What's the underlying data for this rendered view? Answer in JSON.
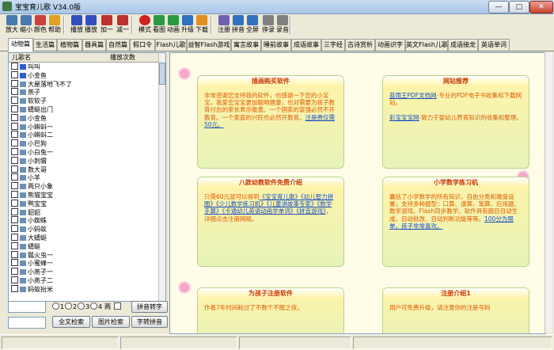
{
  "window": {
    "title": "宝宝育儿歌 V34.0版",
    "min": "—",
    "max": "□",
    "close": "✕"
  },
  "toolbar": {
    "buttons": [
      {
        "label": "放大",
        "icon": "zoom-in-icon",
        "color": "#4a7ab0"
      },
      {
        "label": "缩小",
        "icon": "zoom-out-icon",
        "color": "#4a7ab0"
      },
      {
        "label": "颜色",
        "icon": "color-icon",
        "color": "#d04040"
      },
      {
        "label": "帮助",
        "icon": "help-icon",
        "color": "#e0a020"
      },
      {
        "label": "播放",
        "icon": "play-icon",
        "color": "#3050c0"
      },
      {
        "label": "播放",
        "icon": "play-all-icon",
        "color": "#3050c0"
      },
      {
        "label": "加一",
        "icon": "add-icon",
        "color": "#c03030"
      },
      {
        "label": "减一",
        "icon": "minus-icon",
        "color": "#c03030"
      },
      {
        "label": "模式",
        "icon": "mode-icon",
        "color": "#d02020"
      },
      {
        "label": "看图",
        "icon": "image-icon",
        "color": "#2a9a40"
      },
      {
        "label": "动画",
        "icon": "animation-icon",
        "color": "#2a9a40"
      },
      {
        "label": "升级",
        "icon": "upgrade-icon",
        "color": "#3070c0"
      },
      {
        "label": "下载",
        "icon": "download-icon",
        "color": "#e09020"
      },
      {
        "label": "注册",
        "icon": "register-icon",
        "color": "#7060b0"
      },
      {
        "label": "拼音",
        "icon": "pinyin-icon",
        "color": "#3070c0"
      },
      {
        "label": "全屏",
        "icon": "fullscreen-icon",
        "color": "#3070c0"
      },
      {
        "label": "停录",
        "icon": "stop-record-icon",
        "color": "#808080"
      },
      {
        "label": "录音",
        "icon": "record-icon",
        "color": "#808080"
      }
    ]
  },
  "tabs": [
    "动物篇",
    "生活篇",
    "植物篇",
    "器具篇",
    "自然篇",
    "假口令",
    "Flash儿歌",
    "益智Flash游戏",
    "寓言故事",
    "睡前故事",
    "成语故事",
    "三字经",
    "古诗赏析",
    "动画识字",
    "英文Flash儿歌",
    "成语接龙",
    "英语单词"
  ],
  "list": {
    "headers": {
      "name": "儿歌名",
      "count": "播放次数"
    },
    "items": [
      "叫叫",
      "小金鱼",
      "大屋落地飞不了",
      "燕子",
      "软软子",
      "蜻蜓出门",
      "小金鱼",
      "小蝌蚪一",
      "小蝌蚪二",
      "小巴狗",
      "小白兔一",
      "小刺猬",
      "数大哥",
      "小羊",
      "两只小象",
      "熊猫宝宝",
      "鸭宝宝",
      "貂貂",
      "小蜘蛛",
      "小蚂蚁",
      "大蜻蜓",
      "蜻蜓",
      "瓢火虫一",
      "小蜜蜂一",
      "小燕子一",
      "小燕子二",
      "蚂蚁抬米"
    ]
  },
  "search": {
    "radio_options": [
      "1",
      "2",
      "3",
      "4"
    ],
    "radio_suffix": "两",
    "check_label": "",
    "pinyin_btn": "拼音转字",
    "fulltext_btn": "全文检索",
    "image_btn": "图片检索",
    "char_pinyin_btn": "字转拼音"
  },
  "cards": [
    {
      "title": "插画购买软件",
      "body": "非常感谢您支持我的软件，也感谢一下您的小宝宝，我爱您宝宝更加聪明健康，也对需要为孩子教育付出的家长表示敬意。一个国家的富强必然不开教育。一个家庭的兴旺也必然开教育。",
      "link": "注册费仅需50元。"
    },
    {
      "title": "网站推荐",
      "body": "-专业的PDF电子书收集和下载网站。",
      "link1": "蓝雨王PDF文档网",
      "body2": "-致力于婴幼儿养育知识的收集和整理。",
      "link2": "彩宝宝宝网"
    },
    {
      "title": "八款幼教软件免费介绍",
      "body": "只需60元就可以得到",
      "link": "《宝宝育儿歌》《幼儿智力拼图》《少儿数学练习机》《儿童讲故事专家》《数学手算》《卡通幼儿英语动画学单词》《拼音游戏》",
      "body2": "，详细点击注册网链。"
    },
    {
      "title": "小学数学练习机",
      "body": "囊括了小学数学的所有知识，自由分类和难度设置，支持多种题型：口算、速算、笔算、应用题、数学游戏、Flash同步教学。软件具有题目自动生成、自动批改、自动判断功能等等。",
      "link": "100分为限单，孩子非常喜欢。"
    },
    {
      "title": "为孩子注册软件",
      "body": "作者7年时间耗过了不数个不眠之夜，",
      "link": ""
    },
    {
      "title": "注册介绍1",
      "body": "用户可免费升级，请注意你的注册号码",
      "link": ""
    }
  ]
}
